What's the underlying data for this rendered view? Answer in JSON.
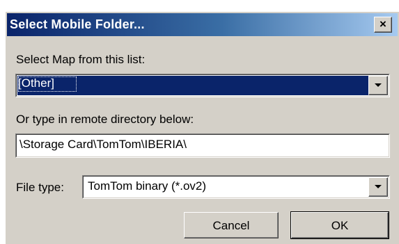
{
  "window": {
    "title": "Select Mobile Folder...",
    "close_label": "×"
  },
  "map_list": {
    "label": "Select Map from this list:",
    "selected": "[Other]"
  },
  "remote_dir": {
    "label": "Or type in remote directory below:",
    "value": "\\Storage Card\\TomTom\\IBERIA\\"
  },
  "file_type": {
    "label": "File type:",
    "selected": "TomTom binary (*.ov2)"
  },
  "buttons": {
    "cancel": "Cancel",
    "ok": "OK"
  },
  "colors": {
    "title_gradient_start": "#0a246a",
    "title_gradient_end": "#a6caf0",
    "dialog_face": "#d4d0c8",
    "selection": "#0a246a"
  },
  "icons": {
    "close": "close-icon",
    "dropdown": "chevron-down-icon"
  }
}
